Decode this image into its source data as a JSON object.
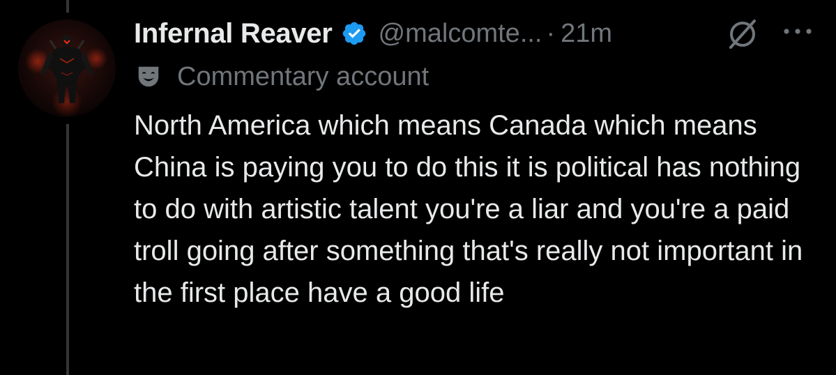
{
  "tweet": {
    "display_name": "Infernal Reaver",
    "verified": true,
    "handle": "@malcomte...",
    "separator": "·",
    "timestamp": "21m",
    "label": "Commentary account",
    "label_icon": "theater-mask-icon",
    "text": "North America which means Canada which means China is paying you to do this it is political has nothing to do with artistic talent you're a liar and you're a paid troll going after something that's really not important in the first place have a good life"
  },
  "icons": {
    "verified": "verified-badge-icon",
    "grok": "grok-icon",
    "more": "more-options-icon",
    "avatar": "avatar-dark-armored-figure"
  },
  "colors": {
    "background": "#000000",
    "primary_text": "#e7e9ea",
    "secondary_text": "#71767b",
    "verified_blue": "#1d9bf0",
    "thread_line": "#333639"
  }
}
